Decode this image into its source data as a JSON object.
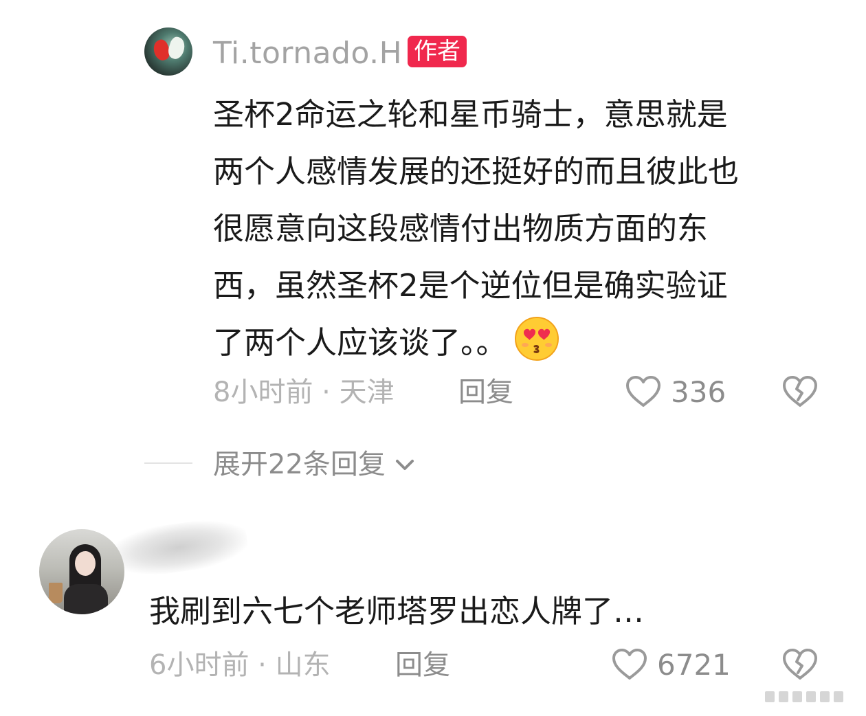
{
  "comment1": {
    "username": "Ti.tornado.H",
    "tag": "作者",
    "lines": [
      "圣杯2命运之轮和星币骑士，意思就是",
      "两个人感情发展的还挺好的而且彼此也",
      "很愿意向这段感情付出物质方面的东",
      "西，虽然圣杯2是个逆位但是确实验证",
      "了两个人应该谈了。。"
    ],
    "emoji": "heart-eyes-kiss-emoji",
    "time": "8小时前",
    "location": "天津",
    "reply": "回复",
    "likes": "336"
  },
  "expand": {
    "label": "展开22条回复"
  },
  "comment2": {
    "text": "我刷到六七个老师塔罗出恋人牌了…",
    "time": "6小时前",
    "location": "山东",
    "reply": "回复",
    "likes": "6721"
  },
  "colors": {
    "author_tag": "#f0284d",
    "text": "#1a1a1a",
    "muted": "#8c8c8c"
  }
}
